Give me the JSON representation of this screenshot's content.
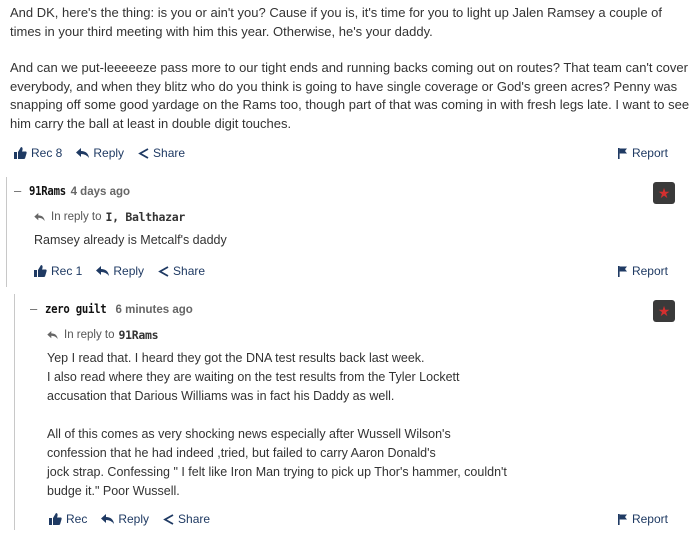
{
  "post": {
    "paragraph1": "And DK, here's the thing:  is you or ain't you?  Cause if you is, it's time for you to light up Jalen Ramsey a couple of times in your third meeting with him this year.  Otherwise, he's your daddy.",
    "paragraph2": "And can we put-leeeeeze pass more to our tight ends and running backs coming out on routes?  That team can't cover everybody, and when they blitz who do you think is going to have single coverage or God's green acres?  Penny was snapping off some good yardage on the Rams too, though part of that was coming in with fresh legs late.  I want to see him carry the ball at least in double digit touches.",
    "rec_label": "Rec 8",
    "reply_label": "Reply",
    "share_label": "Share",
    "report_label": "Report"
  },
  "comments": [
    {
      "dash": "–",
      "username": "91Rams",
      "ago": "4 days ago",
      "in_reply_prefix": "In reply to",
      "in_reply_to": "I, Balthazar",
      "lines": [
        "Ramsey already is Metcalf's daddy"
      ],
      "rec_label": "Rec 1",
      "reply_label": "Reply",
      "share_label": "Share",
      "report_label": "Report"
    },
    {
      "dash": "–",
      "username": "zero guilt",
      "ago": "6 minutes ago",
      "in_reply_prefix": "In reply to",
      "in_reply_to": "91Rams",
      "lines": [
        "Yep I read that. I heard they got the DNA test results back last week.",
        "I also read where they are waiting on the test results from the Tyler Lockett",
        "accusation that Darious Williams was in fact his Daddy as well.",
        "",
        "All of this comes as very shocking news especially after Wussell Wilson's",
        "confession that he had indeed ,tried, but failed to carry Aaron Donald's",
        "jock strap. Confessing \" I felt like Iron Man trying to pick up Thor's hammer, couldn't",
        "budge it.\"  Poor Wussell."
      ],
      "rec_label": "Rec",
      "reply_label": "Reply",
      "share_label": "Share",
      "report_label": "Report"
    }
  ],
  "badge_icon": "star-icon",
  "colors": {
    "link": "#1f3a63",
    "badge_bg": "#3a3a3a",
    "badge_star": "#d32f2f"
  }
}
